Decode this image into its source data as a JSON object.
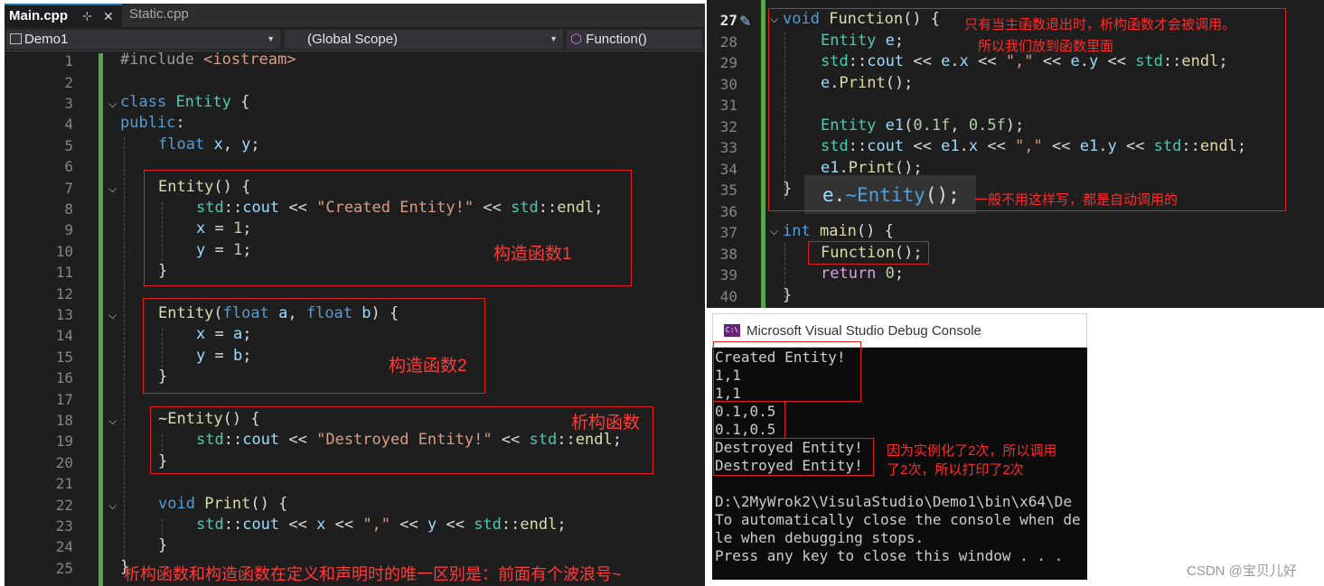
{
  "left_editor": {
    "tabs": {
      "active": "Main.cpp",
      "pin": "⊹",
      "close": "✕",
      "other": "Static.cpp"
    },
    "nav": {
      "project": "Demo1",
      "scope": "(Global Scope)",
      "member": "Function()"
    },
    "line_numbers": [
      "1",
      "2",
      "3",
      "4",
      "5",
      "6",
      "7",
      "8",
      "9",
      "10",
      "11",
      "12",
      "13",
      "14",
      "15",
      "16",
      "17",
      "18",
      "19",
      "20",
      "21",
      "22",
      "23",
      "24",
      "25"
    ],
    "annotations": {
      "ctor1": "构造函数1",
      "ctor2": "构造函数2",
      "dtor": "析构函数",
      "bottom_note": "析构函数和构造函数在定义和声明时的唯一区别是：前面有个波浪号~"
    }
  },
  "right_editor": {
    "line_numbers": [
      "27",
      "28",
      "29",
      "30",
      "31",
      "32",
      "33",
      "34",
      "35",
      "36",
      "37",
      "38",
      "39",
      "40"
    ],
    "annotations": {
      "note1": "只有当主函数退出时，析构函数才会被调用。",
      "note2": "所以我们放到函数里面",
      "note3": "一般不用这样写，都是自动调用的"
    }
  },
  "console": {
    "title": "Microsoft Visual Studio Debug Console",
    "icon": "C:\\",
    "lines": [
      "Created Entity!",
      "1,1",
      "1,1",
      "0.1,0.5",
      "0.1,0.5",
      "Destroyed Entity!",
      "Destroyed Entity!",
      "",
      "D:\\2MyWrok2\\VisulaStudio\\Demo1\\bin\\x64\\De",
      "To automatically close the console when de",
      "le when debugging stops.",
      "Press any key to close this window . . ."
    ],
    "annotation": {
      "line1": "因为实例化了2次，所以调用",
      "line2": "了2次，所以打印了2次"
    }
  },
  "watermark": "CSDN @宝贝儿好",
  "colors": {
    "editor_bg": "#1e1e1e",
    "keyword": "#569cd6",
    "type": "#4ec9b0",
    "function": "#dcdcaa",
    "string": "#d69d85",
    "number": "#b5cea8",
    "annotation_red": "#ff3b3b",
    "change_bar": "#57a64a"
  }
}
